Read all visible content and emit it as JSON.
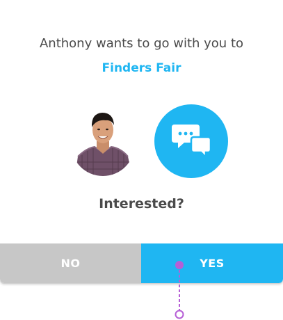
{
  "invite": {
    "message": "Anthony wants to go with you to",
    "event_name": "Finders Fair",
    "question": "Interested?"
  },
  "buttons": {
    "no_label": "NO",
    "yes_label": "YES"
  },
  "icons": {
    "profile": "person-avatar",
    "chat": "chat-bubbles-icon",
    "tap": "tap-indicator"
  },
  "colors": {
    "accent": "#1fb6f2",
    "text": "#4a4a4a",
    "no_button": "#c7c7c7",
    "tap_marker": "#b65fd6"
  }
}
